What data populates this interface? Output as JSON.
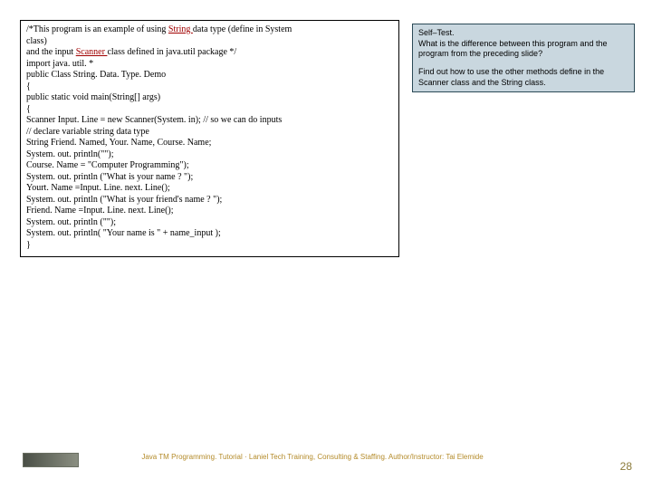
{
  "code": {
    "l1a": "/*This program is an example of using ",
    "l1b": "String ",
    "l1c": "data type (define in System",
    "l2": "              class)",
    "l3a": "   and the input ",
    "l3b": "Scanner ",
    "l3c": "class defined in java.util package */",
    "l4": "import java. util. *",
    "l5": "public Class String. Data. Type. Demo",
    "l6": "{",
    "l7": "   public static void main(String[] args)",
    "l8": "   {",
    "l9": "   Scanner Input. Line = new Scanner(System. in); // so we can do inputs",
    "l10": "   // declare variable string data type",
    "l11": "    String Friend. Named, Your. Name, Course. Name;",
    "l12": "    System. out. println(\"\");",
    "l13": "    Course. Name = \"Computer Programming\");",
    "l14": "    System. out. println (\"What is your name ? \");",
    "l15": "    Yourt. Name =Input. Line. next. Line();",
    "l16": "    System. out. println (\"What is your friend's name ? \");",
    "l17": "   Friend. Name =Input. Line. next. Line();",
    "l18": "    System. out. println (\"\");",
    "blank": " ",
    "l19": " System. out. println( \"Your name is \" + name_input );",
    "l20": "}"
  },
  "selftest": {
    "h": "Self–Test.",
    "p1": "What is the difference between this program and the program from the preceding slide?",
    "p2": "Find out how to use the other methods define in the Scanner class and the String class."
  },
  "footer": {
    "text": "Java TM Programming. Tutorial  ·  Laniel Tech Training, Consulting & Staffing. Author/Instructor: Tai Elemide"
  },
  "page": "28"
}
